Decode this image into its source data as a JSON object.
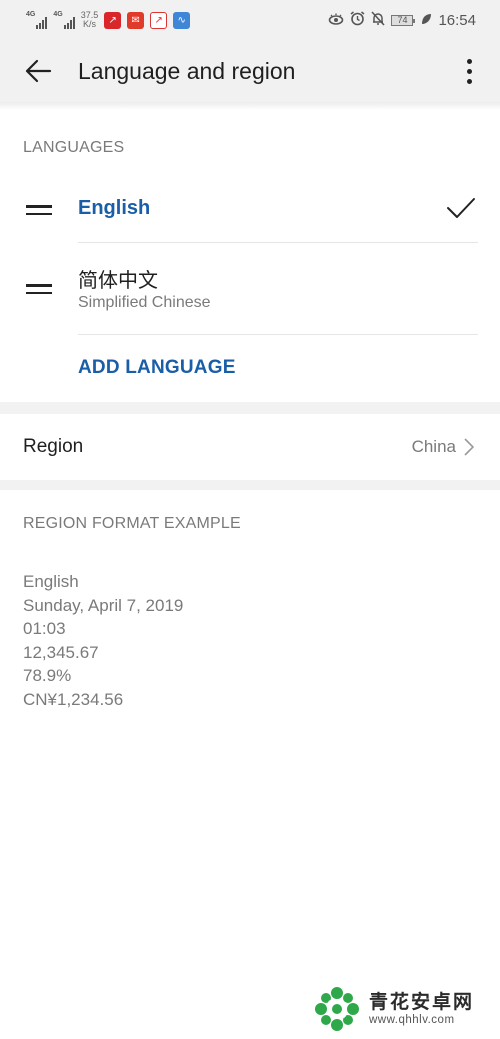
{
  "status_bar": {
    "sim1": "4G",
    "sim2": "4G",
    "net_speed_value": "37.5",
    "net_speed_unit": "K/s",
    "notification_icons": [
      "stock-app-icon",
      "news-app-icon",
      "finance-app-icon",
      "chart-app-icon"
    ],
    "right_icons": [
      "eye-comfort-icon",
      "alarm-icon",
      "bell-muted-icon"
    ],
    "battery_level": "74",
    "time": "16:54"
  },
  "app_bar": {
    "title": "Language and region",
    "back_icon": "arrow-left-icon",
    "more_icon": "more-vert-icon"
  },
  "languages": {
    "header": "LANGUAGES",
    "items": [
      {
        "primary": "English",
        "secondary": "",
        "selected": true
      },
      {
        "primary": "简体中文",
        "secondary": "Simplified Chinese",
        "selected": false
      }
    ],
    "add_label": "ADD LANGUAGE"
  },
  "region": {
    "label": "Region",
    "value": "China"
  },
  "region_format": {
    "header": "REGION FORMAT EXAMPLE",
    "lines": [
      "English",
      "Sunday, April 7, 2019",
      "01:03",
      "12,345.67",
      "78.9%",
      "CN¥1,234.56"
    ]
  },
  "watermark": {
    "name": "青花安卓网",
    "url": "www.qhhlv.com"
  },
  "colors": {
    "accent": "#1a5ea8",
    "secondary_text": "#7a7a7a",
    "bar_background": "#f1f1f1",
    "watermark_green": "#2fa84a"
  }
}
